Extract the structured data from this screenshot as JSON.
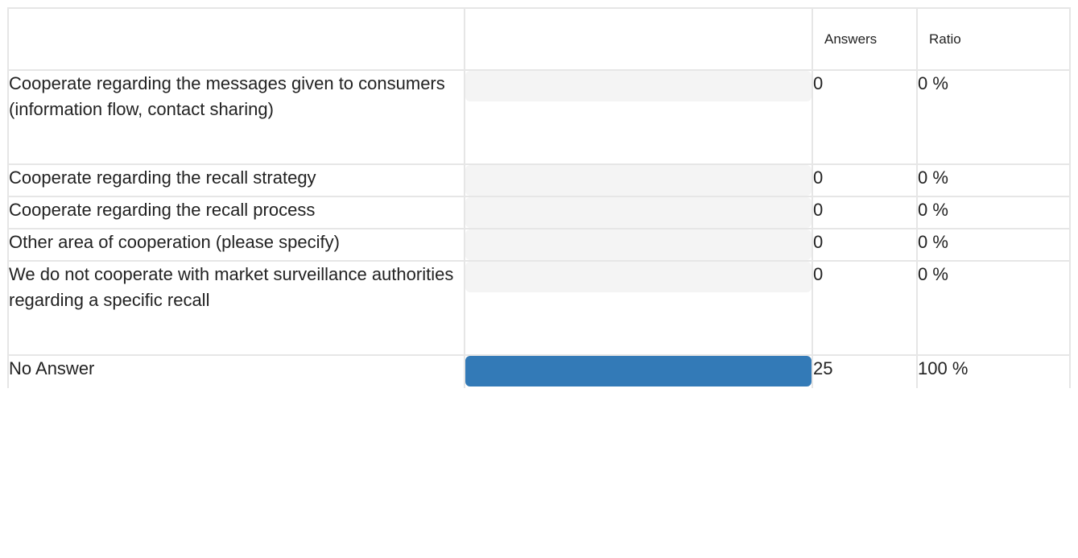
{
  "table": {
    "headers": {
      "label": "",
      "bar": "",
      "answers": "Answers",
      "ratio": "Ratio"
    },
    "rows": [
      {
        "label": "Cooperate regarding the messages given to consumers (information flow, contact sharing)",
        "answers": "0",
        "ratio": "0 %",
        "fraction": 0
      },
      {
        "label": "Cooperate regarding the recall strategy",
        "answers": "0",
        "ratio": "0 %",
        "fraction": 0
      },
      {
        "label": "Cooperate regarding the recall process",
        "answers": "0",
        "ratio": "0 %",
        "fraction": 0
      },
      {
        "label": "Other area of cooperation (please specify)",
        "answers": "0",
        "ratio": "0 %",
        "fraction": 0
      },
      {
        "label": "We do not cooperate with market surveillance authorities regarding a specific recall",
        "answers": "0",
        "ratio": "0 %",
        "fraction": 0
      },
      {
        "label": "No Answer",
        "answers": "25",
        "ratio": "100 %",
        "fraction": 1
      }
    ]
  },
  "colors": {
    "bar_fill": "#337ab7",
    "bar_track": "#f4f4f4",
    "grid": "#e6e6e6"
  }
}
